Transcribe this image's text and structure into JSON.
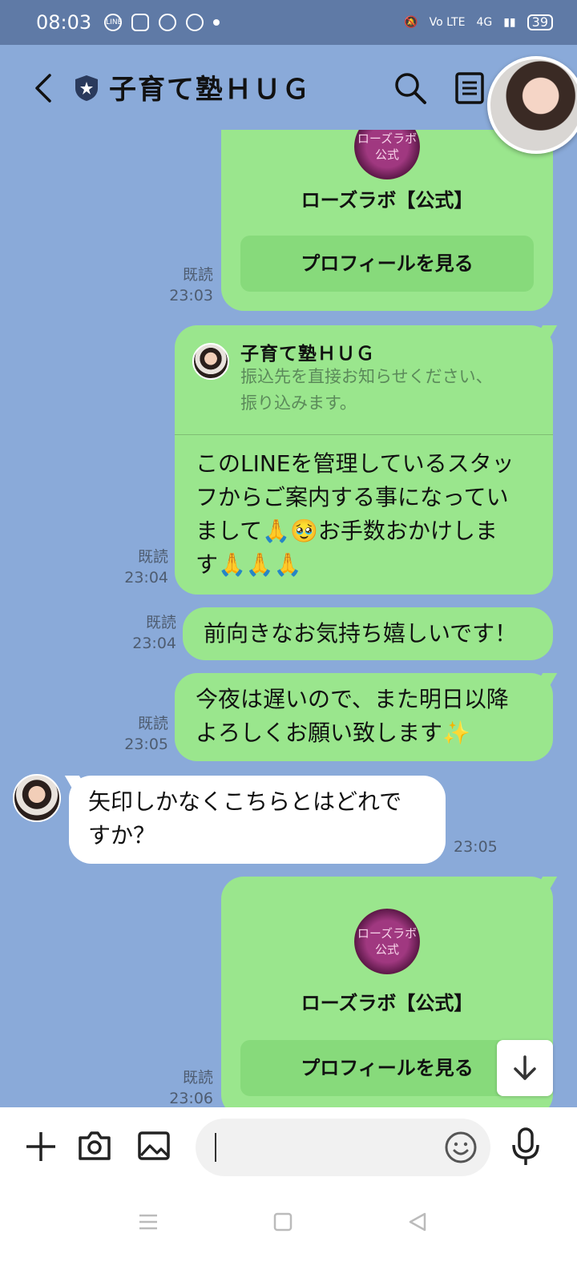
{
  "status_bar": {
    "time": "08:03",
    "battery": "39",
    "network": "4G",
    "volte": "Vo LTE"
  },
  "header": {
    "title": "子育て塾ＨＵＧ"
  },
  "messages": {
    "card1": {
      "logo_text": "ローズラボ 公式",
      "name": "ローズラボ【公式】",
      "button": "プロフィールを見る",
      "read": "既読",
      "time": "23:03"
    },
    "reply": {
      "quote_name": "子育て塾ＨＵＧ",
      "quote_text_1": "振込先を直接お知らせください、",
      "quote_text_2": "振り込みます。",
      "line1": "このLINEを管理しているスタッ",
      "line2": "フからご案内する事になってい",
      "line3": "まして🙏🥹お手数おかけしま",
      "line4": "す🙏🙏🙏",
      "read": "既読",
      "time": "23:04"
    },
    "msg2": {
      "text": "前向きなお気持ち嬉しいです！",
      "read": "既読",
      "time": "23:04"
    },
    "msg3": {
      "line1": "今夜は遅いので、また明日以降",
      "line2": "よろしくお願い致します✨",
      "read": "既読",
      "time": "23:05"
    },
    "incoming": {
      "line1": "矢印しかなくこちらとはどれで",
      "line2": "すか？",
      "time": "23:05"
    },
    "card2": {
      "logo_text": "ローズラボ 公式",
      "name": "ローズラボ【公式】",
      "button": "プロフィールを見る",
      "read": "既読",
      "time": "23:06"
    }
  },
  "input": {
    "placeholder": ""
  },
  "colors": {
    "background": "#8aaad9",
    "bubble_out": "#9ae68d",
    "bubble_in": "#ffffff"
  }
}
